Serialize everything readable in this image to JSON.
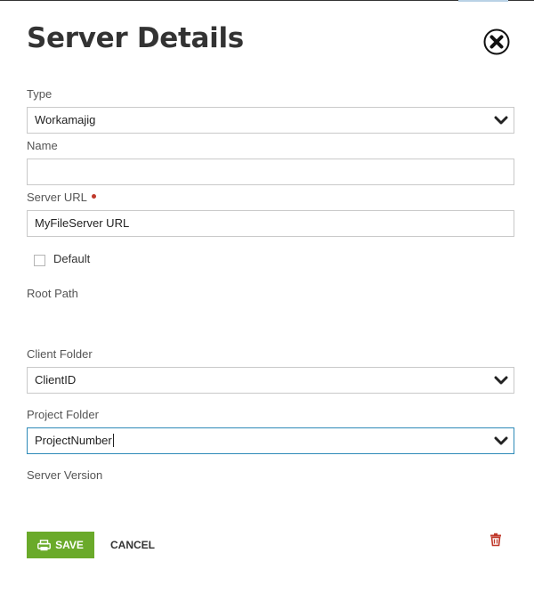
{
  "dialog": {
    "title": "Server Details"
  },
  "fields": {
    "type": {
      "label": "Type",
      "value": "Workamajig"
    },
    "name": {
      "label": "Name",
      "value": ""
    },
    "server_url": {
      "label": "Server URL",
      "value": "MyFileServer URL"
    },
    "default": {
      "label": "Default",
      "checked": false
    },
    "root_path": {
      "label": "Root Path"
    },
    "client_folder": {
      "label": "Client Folder",
      "value": "ClientID"
    },
    "project_folder": {
      "label": "Project Folder",
      "value": "ProjectNumber"
    },
    "server_version": {
      "label": "Server Version"
    }
  },
  "actions": {
    "save_label": "SAVE",
    "cancel_label": "CANCEL"
  },
  "icons": {
    "close": "close-circle-icon",
    "dropdown": "chevron-down-icon",
    "save": "printer-icon",
    "delete": "trash-icon"
  },
  "colors": {
    "save_bg": "#6aaa2a",
    "required": "#c0392b",
    "delete": "#c0392b",
    "focus": "#2e8ab8"
  }
}
